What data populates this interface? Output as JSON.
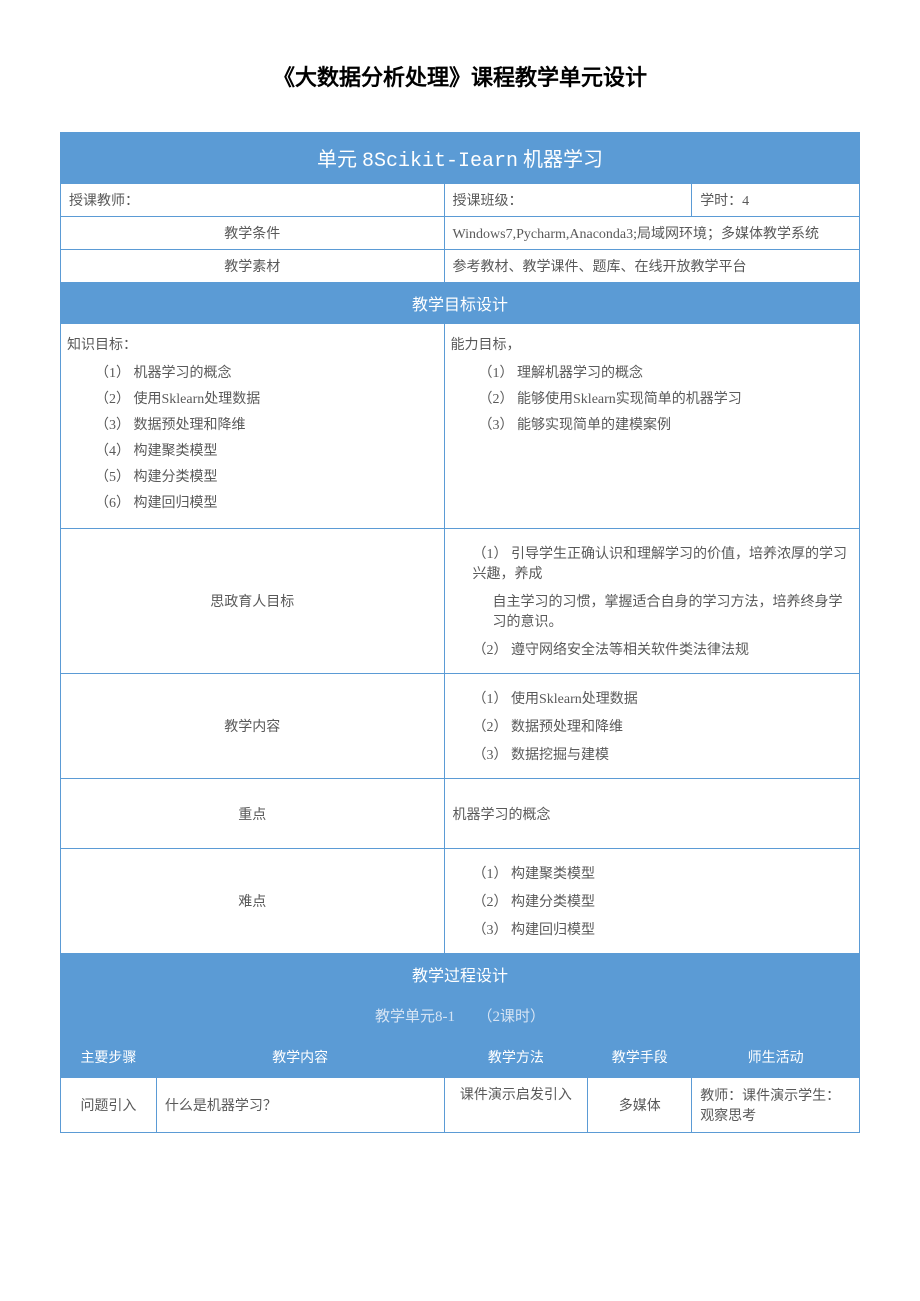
{
  "title": "《大数据分析处理》课程教学单元设计",
  "unit_header": {
    "prefix": "单元",
    "code": "8Scikit-Iearn",
    "suffix": "机器学习"
  },
  "info": {
    "teacher_label": "授课教师：",
    "class_label": "授课班级：",
    "hours_label": "学时：4",
    "cond_label": "教学条件",
    "cond_value": "Windows7,Pycharm,Anaconda3;局域网环境；多媒体教学系统",
    "mat_label": "教学素材",
    "mat_value": "参考教材、教学课件、题库、在线开放教学平台"
  },
  "goal_section": "教学目标设计",
  "knowledge_goal": {
    "head": "知识目标：",
    "items": [
      "（1）   机器学习的概念",
      "（2）   使用Sklearn处理数据",
      "（3）   数据预处理和降维",
      "（4）   构建聚类模型",
      "（5）   构建分类模型",
      "（6）   构建回归模型"
    ]
  },
  "ability_goal": {
    "head": "能力目标，",
    "items": [
      "（1）   理解机器学习的概念",
      "（2）   能够使用Sklearn实现简单的机器学习",
      "（3）   能够实现简单的建模案例"
    ]
  },
  "ideology": {
    "label": "思政育人目标",
    "items": [
      "（1）   引导学生正确认识和理解学习的价值，培养浓厚的学习兴趣，养成",
      "自主学习的习惯，掌握适合自身的学习方法，培养终身学习的意识。",
      "（2）   遵守网络安全法等相关软件类法律法规"
    ]
  },
  "content": {
    "label": "教学内容",
    "items": [
      "（1）   使用Sklearn处理数据",
      "（2）   数据预处理和降维",
      "（3）   数据挖掘与建模"
    ]
  },
  "key": {
    "label": "重点",
    "value": "机器学习的概念"
  },
  "difficulty": {
    "label": "难点",
    "items": [
      "（1）   构建聚类模型",
      "（2）   构建分类模型",
      "（3）   构建回归模型"
    ]
  },
  "process_section": "教学过程设计",
  "subunit": {
    "left": "教学单元8-1",
    "right": "（2课时）"
  },
  "table": {
    "headers": {
      "step": "主要步骤",
      "content": "教学内容",
      "method": "教学方法",
      "means": "教学手段",
      "activity": "师生活动"
    },
    "row1": {
      "step": "问题引入",
      "content": "什么是机器学习？",
      "method": "课件演示启发引入",
      "means": "多媒体",
      "activity": "教师：课件演示学生：观察思考"
    }
  }
}
